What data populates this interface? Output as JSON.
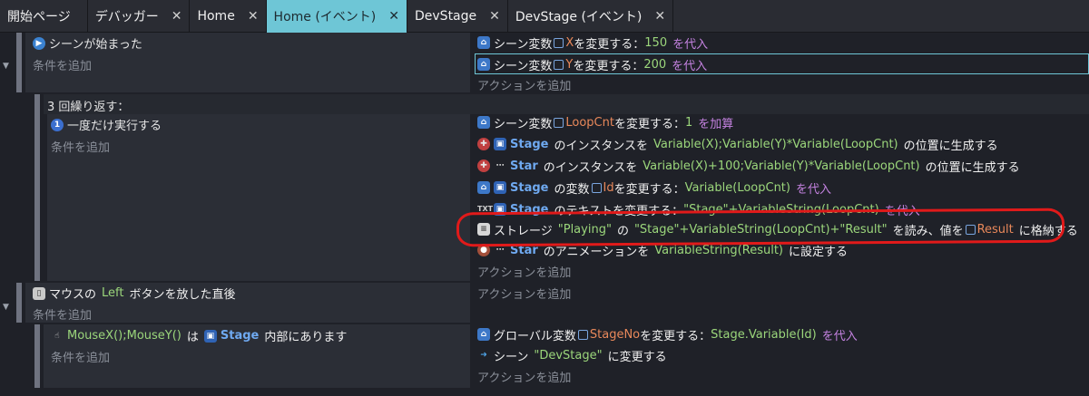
{
  "tabs": [
    {
      "label": "開始ページ",
      "active": false,
      "closable": false
    },
    {
      "label": "デバッガー",
      "active": false,
      "closable": true
    },
    {
      "label": "Home",
      "active": false,
      "closable": true
    },
    {
      "label": "Home (イベント)",
      "active": true,
      "closable": true
    },
    {
      "label": "DevStage",
      "active": false,
      "closable": true
    },
    {
      "label": "DevStage (イベント)",
      "active": false,
      "closable": true
    }
  ],
  "event1": {
    "condition": "シーンが始まった",
    "add_condition": "条件を追加",
    "actions": [
      {
        "p1": "シーン変数",
        "var": "X",
        "p2": "を変更する：",
        "val": "150",
        "op": "を代入"
      },
      {
        "p1": "シーン変数",
        "var": "Y",
        "p2": "を変更する：",
        "val": "200",
        "op": "を代入"
      }
    ],
    "add_action": "アクションを追加"
  },
  "repeat": {
    "header": "3 回繰り返す：",
    "condition": "一度だけ実行する",
    "add_condition": "条件を追加",
    "a1": {
      "p1": "シーン変数",
      "var": "LoopCnt",
      "p2": "を変更する：",
      "val": "1",
      "op": "を加算"
    },
    "a2": {
      "obj": "Stage",
      "p1": "のインスタンスを",
      "expr": "Variable(X);Variable(Y)*Variable(LoopCnt)",
      "p2": "の位置に生成する"
    },
    "a3": {
      "obj": "Star",
      "p1": "のインスタンスを",
      "expr": "Variable(X)+100;Variable(Y)*Variable(LoopCnt)",
      "p2": "の位置に生成する"
    },
    "a4": {
      "obj": "Stage",
      "p1": "の変数",
      "var": "Id",
      "p2": "を変更する：",
      "val": "Variable(LoopCnt)",
      "op": "を代入"
    },
    "a5": {
      "obj": "Stage",
      "p1": "のテキストを変更する：",
      "val": "\"Stage\"+VariableString(LoopCnt)",
      "op": "を代入"
    },
    "a6": {
      "p1": "ストレージ",
      "storage": "\"Playing\"",
      "p2": "の",
      "key": "\"Stage\"+VariableString(LoopCnt)+\"Result\"",
      "p3": "を読み、値を",
      "var": "Result",
      "p4": "に格納する"
    },
    "a7": {
      "obj": "Star",
      "p1": "のアニメーションを",
      "val": "VariableString(Result)",
      "p2": "に設定する"
    },
    "add_action": "アクションを追加"
  },
  "event2": {
    "p1": "マウスの",
    "button": "Left",
    "p2": "ボタンを放した直後",
    "add_condition": "条件を追加",
    "add_action": "アクションを追加"
  },
  "sub2": {
    "expr": "MouseX();MouseY()",
    "p1": "は",
    "obj": "Stage",
    "p2": "内部にあります",
    "add_condition": "条件を追加",
    "a1": {
      "p1": "グローバル変数",
      "var": "StageNo",
      "p2": "を変更する：",
      "val": "Stage.Variable(Id)",
      "op": "を代入"
    },
    "a2": {
      "p1": "シーン",
      "scene": "\"DevStage\"",
      "p2": "に変更する"
    },
    "add_action": "アクションを追加"
  }
}
